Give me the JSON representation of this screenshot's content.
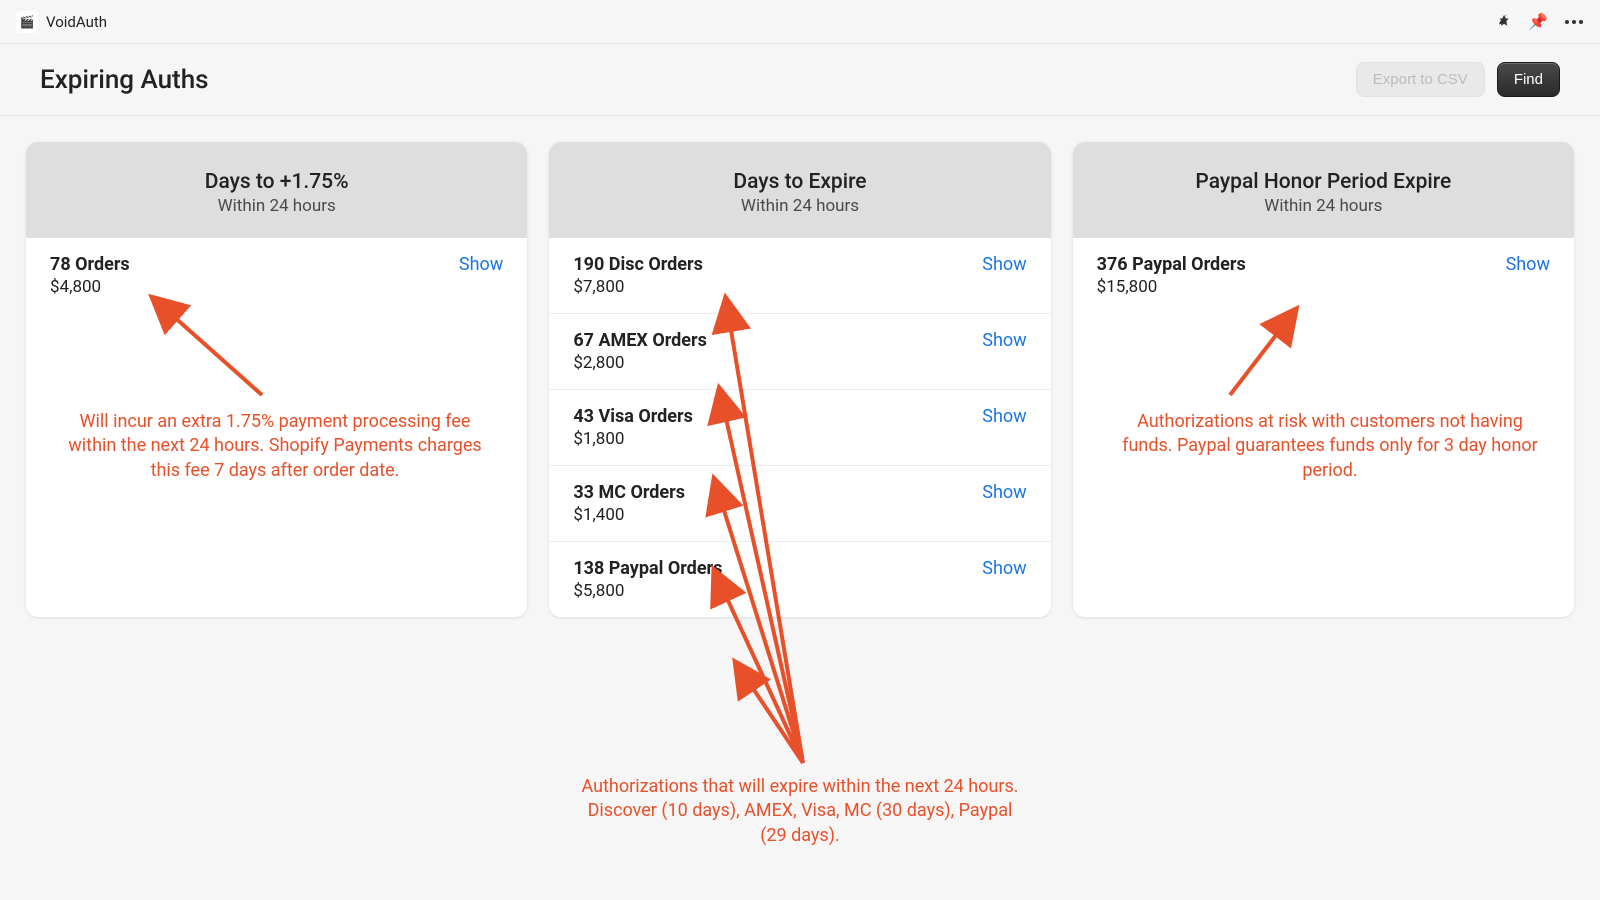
{
  "app": {
    "name": "VoidAuth",
    "icon": "🎬"
  },
  "page": {
    "title": "Expiring Auths"
  },
  "actions": {
    "export_label": "Export to CSV",
    "find_label": "Find"
  },
  "show_label": "Show",
  "cards": [
    {
      "title": "Days to +1.75%",
      "subtitle": "Within 24 hours",
      "rows": [
        {
          "title": "78 Orders",
          "amount": "$4,800"
        }
      ]
    },
    {
      "title": "Days to Expire",
      "subtitle": "Within 24 hours",
      "rows": [
        {
          "title": "190 Disc Orders",
          "amount": "$7,800"
        },
        {
          "title": "67 AMEX Orders",
          "amount": "$2,800"
        },
        {
          "title": "43 Visa Orders",
          "amount": "$1,800"
        },
        {
          "title": "33 MC Orders",
          "amount": "$1,400"
        },
        {
          "title": "138 Paypal Orders",
          "amount": "$5,800"
        }
      ]
    },
    {
      "title": "Paypal Honor Period Expire",
      "subtitle": "Within 24 hours",
      "rows": [
        {
          "title": "376 Paypal Orders",
          "amount": "$15,800"
        }
      ]
    }
  ],
  "annotations": {
    "left": "Will incur an extra 1.75% payment processing fee within the next 24 hours.  Shopify Payments charges this fee 7 days after order date.",
    "middle": "Authorizations that will expire within the next 24 hours.  Discover (10 days), AMEX, Visa, MC (30 days), Paypal (29 days).",
    "right": "Authorizations at risk with customers not having funds.  Paypal guarantees funds only for 3 day honor period."
  }
}
